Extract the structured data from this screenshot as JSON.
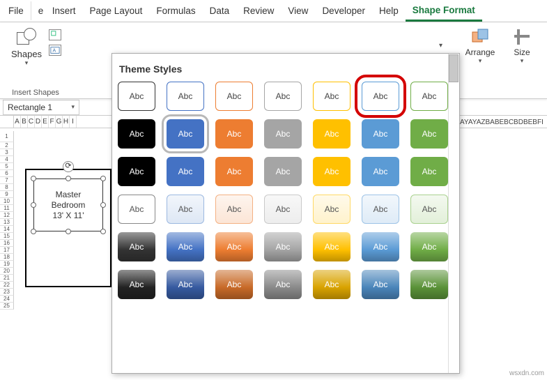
{
  "tabs": {
    "file": "File",
    "partial": "e",
    "insert": "Insert",
    "pagelayout": "Page Layout",
    "formulas": "Formulas",
    "data": "Data",
    "review": "Review",
    "view": "View",
    "developer": "Developer",
    "help": "Help",
    "shapeformat": "Shape Format"
  },
  "ribbon": {
    "shapes_label": "Shapes",
    "group_label": "Insert Shapes",
    "arrange_label": "Arrange",
    "size_label": "Size"
  },
  "namebox": {
    "value": "Rectangle 1"
  },
  "column_letters": [
    "A",
    "B",
    "C",
    "D",
    "E",
    "F",
    "G",
    "H",
    "I"
  ],
  "row_numbers": [
    "1",
    "2",
    "3",
    "4",
    "5",
    "6",
    "7",
    "8",
    "9",
    "10",
    "11",
    "12",
    "13",
    "14",
    "15",
    "16",
    "17",
    "18",
    "19",
    "20",
    "21",
    "22",
    "23",
    "24",
    "25"
  ],
  "right_cols": "AYAYAZBABEBCBDBEBFI",
  "shape": {
    "text": "Master\nBedroom\n13' X 11'"
  },
  "gallery": {
    "title": "Theme Styles",
    "sample": "Abc",
    "rows": [
      {
        "type": "outline",
        "colors": [
          "#333",
          "#4472c4",
          "#ed7d31",
          "#a5a5a5",
          "#ffc000",
          "#5b9bd5",
          "#70ad47"
        ],
        "highlight": 5
      },
      {
        "type": "solid",
        "colors": [
          "#000",
          "#4472c4",
          "#ed7d31",
          "#a5a5a5",
          "#ffc000",
          "#5b9bd5",
          "#70ad47"
        ],
        "selgray": 1
      },
      {
        "type": "solid",
        "colors": [
          "#000",
          "#4472c4",
          "#ed7d31",
          "#a5a5a5",
          "#ffc000",
          "#5b9bd5",
          "#70ad47"
        ]
      },
      {
        "type": "light",
        "colors": [
          "#888",
          "#9bb8e0",
          "#f4b183",
          "#c9c9c9",
          "#ffd966",
          "#9dc3e6",
          "#a9d18e"
        ]
      },
      {
        "type": "grad",
        "colors": [
          "#333",
          "#4472c4",
          "#ed7d31",
          "#a5a5a5",
          "#ffc000",
          "#5b9bd5",
          "#70ad47"
        ]
      },
      {
        "type": "grad",
        "colors": [
          "#222",
          "#365aa0",
          "#c86a28",
          "#8a8a8a",
          "#d9a300",
          "#4a85ba",
          "#5a9238"
        ]
      }
    ]
  },
  "watermark": "wsxdn.com"
}
